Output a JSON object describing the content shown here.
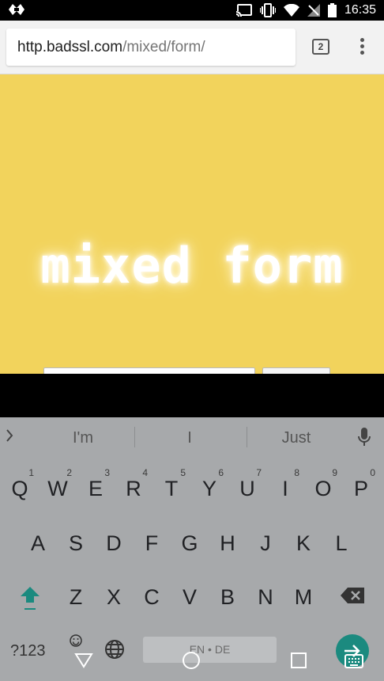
{
  "status_bar": {
    "time": "16:35"
  },
  "browser": {
    "url_host": "http.badssl.com",
    "url_path": "/mixed/form/",
    "tab_count": "2"
  },
  "page": {
    "headline": "mixed form"
  },
  "keyboard": {
    "suggestions": [
      "I'm",
      "I",
      "Just"
    ],
    "row1": [
      {
        "key": "Q",
        "hint": "1"
      },
      {
        "key": "W",
        "hint": "2"
      },
      {
        "key": "E",
        "hint": "3"
      },
      {
        "key": "R",
        "hint": "4"
      },
      {
        "key": "T",
        "hint": "5"
      },
      {
        "key": "Y",
        "hint": "6"
      },
      {
        "key": "U",
        "hint": "7"
      },
      {
        "key": "I",
        "hint": "8"
      },
      {
        "key": "O",
        "hint": "9"
      },
      {
        "key": "P",
        "hint": "0"
      }
    ],
    "row2": [
      "A",
      "S",
      "D",
      "F",
      "G",
      "H",
      "J",
      "K",
      "L"
    ],
    "row3": [
      "Z",
      "X",
      "C",
      "V",
      "B",
      "N",
      "M"
    ],
    "symbols_label": "?123",
    "space_label": "EN • DE",
    "accent_color": "#1b8a7f"
  },
  "navigation": {
    "icons": [
      "back-triangle-icon",
      "home-circle-icon",
      "recents-square-icon",
      "keyboard-switch-icon"
    ]
  }
}
